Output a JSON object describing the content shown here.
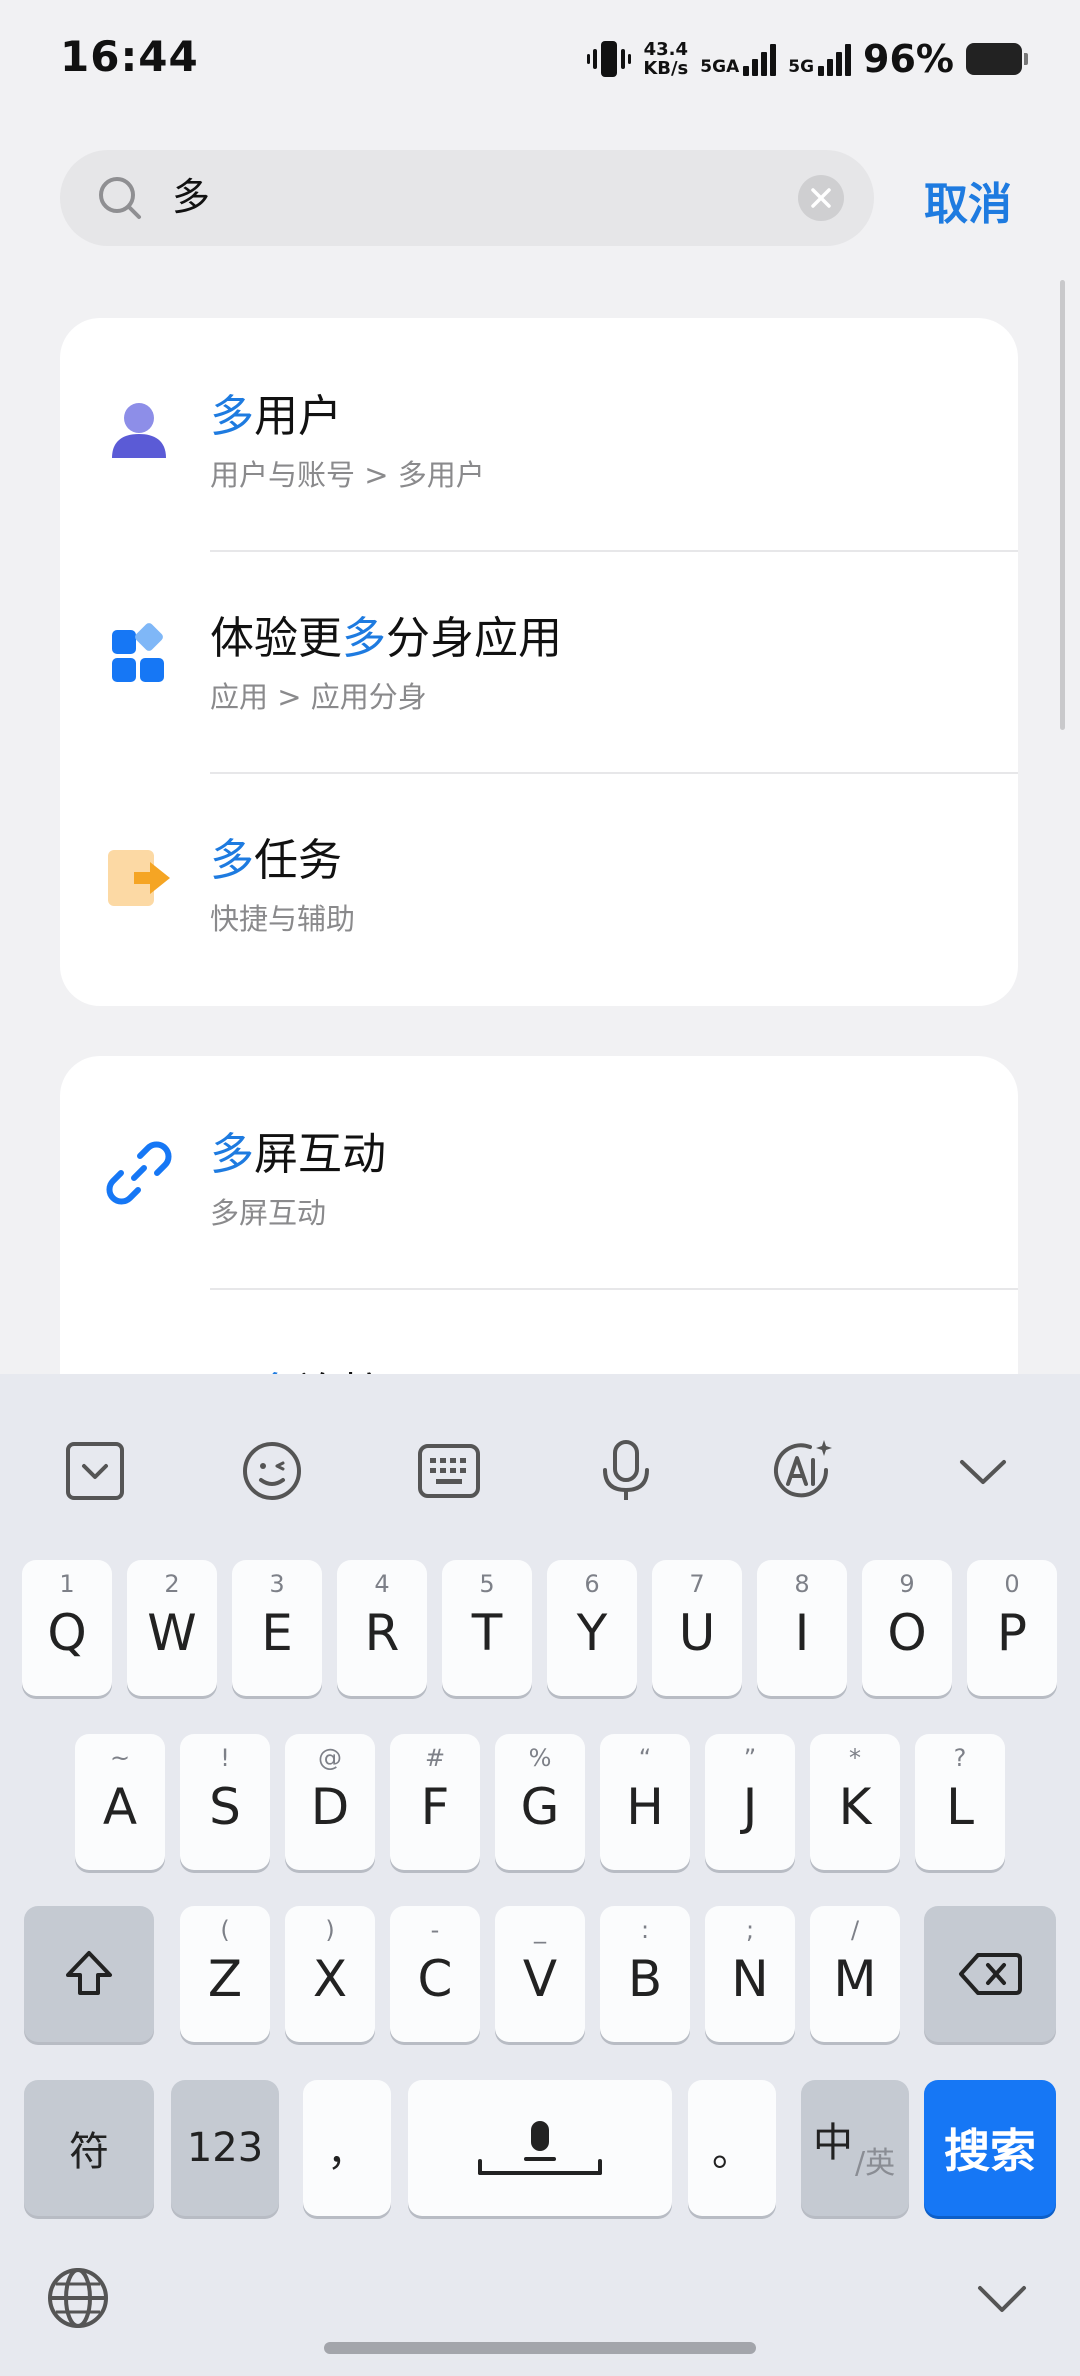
{
  "status": {
    "time": "16:44",
    "net_speed_value": "43.4",
    "net_speed_unit": "KB/s",
    "sim1": "5GA",
    "sim2": "5G",
    "battery": "96%"
  },
  "search": {
    "query": "多",
    "cancel": "取消"
  },
  "results": [
    {
      "hl_pre": "",
      "hl": "多",
      "rest": "用户",
      "path": "用户与账号 > 多用户",
      "icon": "user-icon"
    },
    {
      "hl_pre": "体验更",
      "hl": "多",
      "rest": "分身应用",
      "path": "应用 > 应用分身",
      "icon": "app-grid-icon"
    },
    {
      "hl_pre": "",
      "hl": "多",
      "rest": "任务",
      "path": "快捷与辅助",
      "icon": "multitask-icon"
    },
    {
      "hl_pre": "",
      "hl": "多",
      "rest": "屏互动",
      "path": "多屏互动",
      "icon": "link-icon"
    },
    {
      "hl_pre": "更",
      "hl": "多",
      "rest": "连接",
      "path": "",
      "icon": "connect-icon"
    }
  ],
  "keyboard": {
    "row1": [
      {
        "c": "Q",
        "n": "1"
      },
      {
        "c": "W",
        "n": "2"
      },
      {
        "c": "E",
        "n": "3"
      },
      {
        "c": "R",
        "n": "4"
      },
      {
        "c": "T",
        "n": "5"
      },
      {
        "c": "Y",
        "n": "6"
      },
      {
        "c": "U",
        "n": "7"
      },
      {
        "c": "I",
        "n": "8"
      },
      {
        "c": "O",
        "n": "9"
      },
      {
        "c": "P",
        "n": "0"
      }
    ],
    "row2": [
      {
        "c": "A",
        "n": "~"
      },
      {
        "c": "S",
        "n": "!"
      },
      {
        "c": "D",
        "n": "@"
      },
      {
        "c": "F",
        "n": "#"
      },
      {
        "c": "G",
        "n": "%"
      },
      {
        "c": "H",
        "n": "“"
      },
      {
        "c": "J",
        "n": "”"
      },
      {
        "c": "K",
        "n": "*"
      },
      {
        "c": "L",
        "n": "?"
      }
    ],
    "row3": [
      {
        "c": "Z",
        "n": "("
      },
      {
        "c": "X",
        "n": ")"
      },
      {
        "c": "C",
        "n": "-"
      },
      {
        "c": "V",
        "n": "_"
      },
      {
        "c": "B",
        "n": ":"
      },
      {
        "c": "N",
        "n": ";"
      },
      {
        "c": "M",
        "n": "/"
      }
    ],
    "symbol_key": "符",
    "num_key": "123",
    "comma_key": "，",
    "period_key": "。",
    "lang_main": "中",
    "lang_alt": "英",
    "search_key": "搜索"
  }
}
